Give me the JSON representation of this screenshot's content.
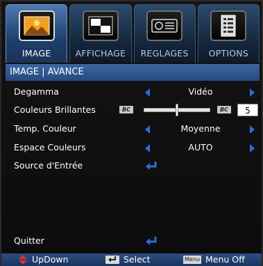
{
  "tabs": [
    {
      "label": "IMAGE",
      "active": true,
      "icon": "picture-icon"
    },
    {
      "label": "AFFICHAGE",
      "active": false,
      "icon": "display-icon"
    },
    {
      "label": "REGLAGES",
      "active": false,
      "icon": "projector-icon"
    },
    {
      "label": "OPTIONS",
      "active": false,
      "icon": "options-icon"
    }
  ],
  "header": {
    "title": "IMAGE | AVANCE"
  },
  "rows": {
    "degamma": {
      "label": "Degamma",
      "value": "Vidéo"
    },
    "brilliant_color": {
      "label": "Couleurs Brillantes",
      "value": "5",
      "left_icon_text": "BC",
      "right_icon_text": "BC",
      "level_fraction": 0.5
    },
    "color_temp": {
      "label": "Temp. Couleur",
      "value": "Moyenne"
    },
    "color_space": {
      "label": "Espace Couleurs",
      "value": "AUTO"
    },
    "input_source": {
      "label": "Source d'Entrée"
    },
    "quit": {
      "label": "Quitter"
    }
  },
  "footer": {
    "updown": "UpDown",
    "select": "Select",
    "menu_key": "Menu",
    "menu_off": "Menu Off"
  },
  "colors": {
    "accent": "#2f6cd8",
    "header": "#3e66a0",
    "footer": "#2c4e82"
  }
}
